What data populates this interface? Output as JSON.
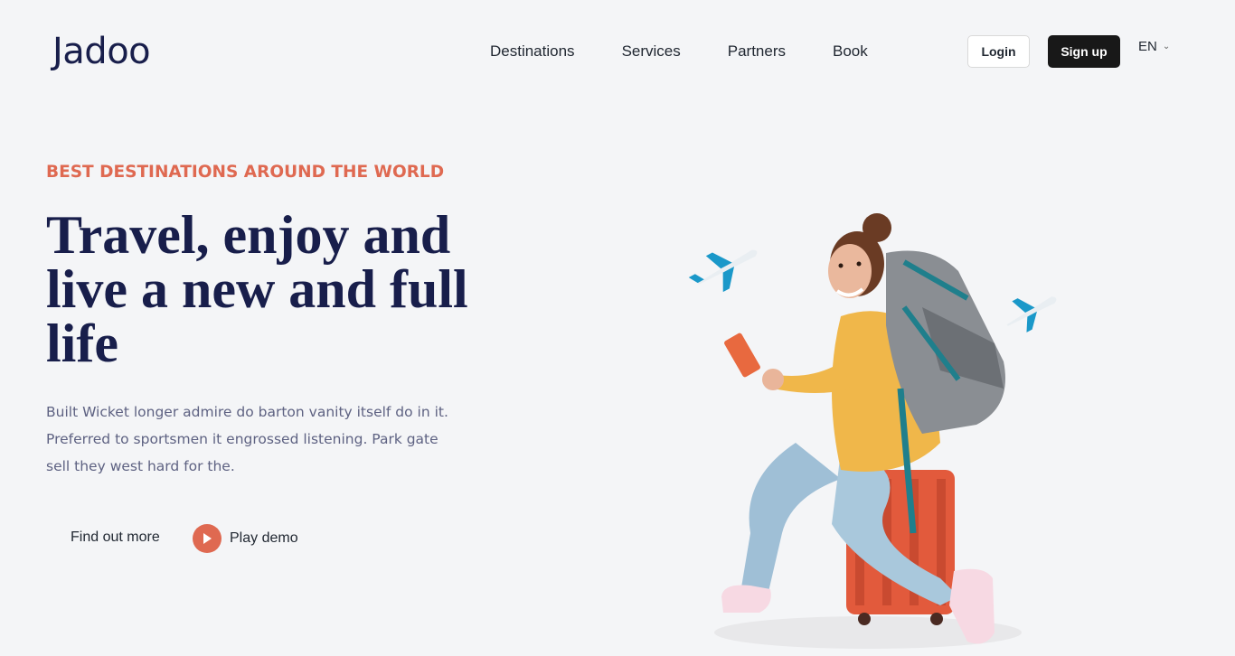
{
  "header": {
    "logo": "Jadoo",
    "nav": [
      "Destinations",
      "Services",
      "Partners",
      "Book"
    ],
    "login_label": "Login",
    "signup_label": "Sign up",
    "language": "EN"
  },
  "hero": {
    "eyebrow": "BEST DESTINATIONS AROUND THE WORLD",
    "headline_lines": [
      "Travel, enjoy and",
      "live a new and full",
      "life"
    ],
    "description_lines": [
      "Built Wicket longer admire do barton vanity itself do in it.",
      "Preferred to sportsmen it engrossed listening. Park gate",
      "sell they west hard for the."
    ],
    "find_out_more_label": "Find out more",
    "play_demo_label": "Play demo",
    "icons": {
      "play": "play-icon",
      "plane": "plane-icon",
      "traveler": "traveler-illustration"
    },
    "colors": {
      "accent": "#df6951",
      "heading": "#181e4b",
      "body": "#5e6282"
    }
  }
}
